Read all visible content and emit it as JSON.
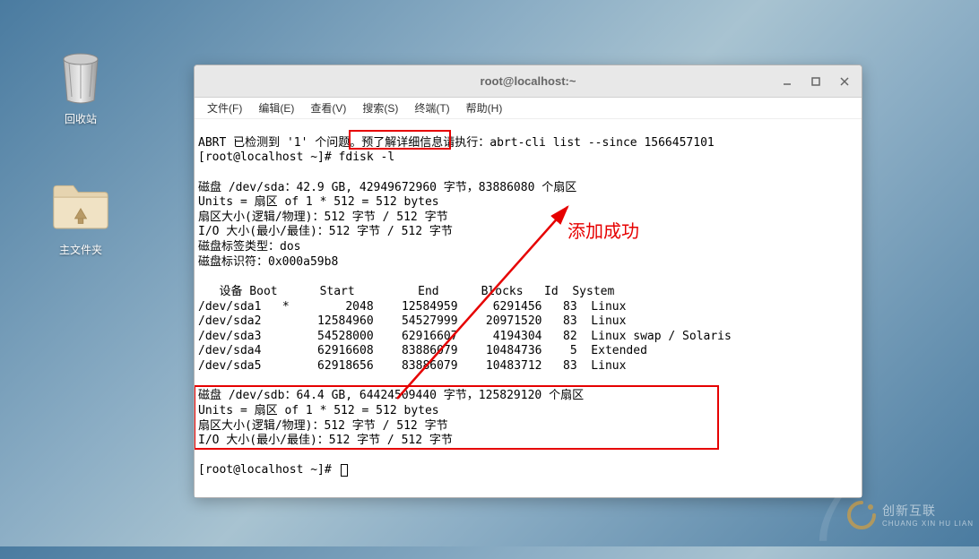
{
  "desktop": {
    "trash_label": "回收站",
    "home_label": "主文件夹"
  },
  "window": {
    "title": "root@localhost:~",
    "menu": {
      "file": "文件(F)",
      "edit": "编辑(E)",
      "view": "查看(V)",
      "search": "搜索(S)",
      "terminal": "终端(T)",
      "help": "帮助(H)"
    }
  },
  "terminal": {
    "abrt_line": "ABRT 已检测到 '1' 个问题。预了解详细信息请执行：abrt-cli list --since 1566457101",
    "prompt1": "[root@localhost ~]# ",
    "cmd1": "fdisk -l",
    "blank": "",
    "disk_a_line": "磁盘 /dev/sda：42.9 GB, 42949672960 字节，83886080 个扇区",
    "units_line_a": "Units = 扇区 of 1 * 512 = 512 bytes",
    "sector_size_a": "扇区大小(逻辑/物理)：512 字节 / 512 字节",
    "io_size_a": "I/O 大小(最小/最佳)：512 字节 / 512 字节",
    "label_type": "磁盘标签类型：dos",
    "disk_ident": "磁盘标识符：0x000a59b8",
    "part_header": "   设备 Boot      Start         End      Blocks   Id  System",
    "parts": [
      "/dev/sda1   *        2048    12584959     6291456   83  Linux",
      "/dev/sda2        12584960    54527999    20971520   83  Linux",
      "/dev/sda3        54528000    62916607     4194304   82  Linux swap / Solaris",
      "/dev/sda4        62916608    83886079    10484736    5  Extended",
      "/dev/sda5        62918656    83886079    10483712   83  Linux"
    ],
    "disk_b_line": "磁盘 /dev/sdb：64.4 GB, 64424509440 字节，125829120 个扇区",
    "units_line_b": "Units = 扇区 of 1 * 512 = 512 bytes",
    "sector_size_b": "扇区大小(逻辑/物理)：512 字节 / 512 字节",
    "io_size_b": "I/O 大小(最小/最佳)：512 字节 / 512 字节",
    "prompt2": "[root@localhost ~]# "
  },
  "annotation": {
    "success_text": "添加成功"
  },
  "watermark": {
    "main": "创新互联",
    "sub": "CHUANG XIN HU LIAN"
  }
}
